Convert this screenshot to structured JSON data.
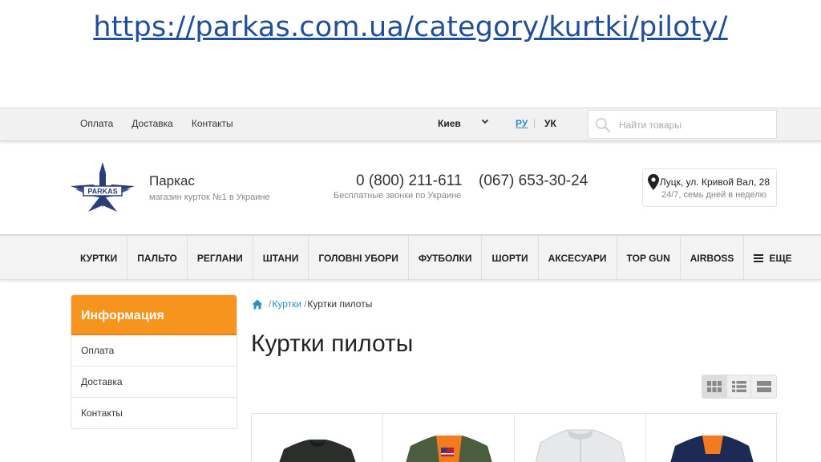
{
  "slide": {
    "url": "https://parkas.com.ua/category/kurtki/piloty/"
  },
  "topbar": {
    "links": [
      "Оплата",
      "Доставка",
      "Контакты"
    ],
    "city": "Киев",
    "lang_ru": "РУ",
    "lang_uk": "УК",
    "search_placeholder": "Найти товары"
  },
  "header": {
    "logo_text": "PARKAS",
    "brand_name": "Паркас",
    "tagline": "магазин курток №1 в Украине",
    "phone_free": "0 (800) 211-611",
    "phone_free_note": "Бесплатные звонки по Украине",
    "phone_mobile": "(067) 653-30-24",
    "address": "Луцк, ул. Кривой Вал, 28",
    "hours": "24/7, семь дней в неделю"
  },
  "nav": {
    "items": [
      "КУРТКИ",
      "ПАЛЬТО",
      "РЕГЛАНИ",
      "ШТАНИ",
      "ГОЛОВНІ УБОРИ",
      "ФУТБОЛКИ",
      "ШОРТИ",
      "АКСЕСУАРИ",
      "TOP GUN",
      "AIRBOSS"
    ],
    "more_label": "ЕЩЕ"
  },
  "sidebar": {
    "title": "Информация",
    "items": [
      "Оплата",
      "Доставка",
      "Контакты"
    ]
  },
  "breadcrumb": {
    "parent": "Куртки",
    "current": "Куртки пилоты"
  },
  "page": {
    "title": "Куртки пилоты"
  },
  "view_modes": {
    "active": "grid"
  },
  "products": [
    {
      "color": "#2b2f2c",
      "lining": "#1e2220"
    },
    {
      "color": "#4a5d3e",
      "lining": "#f47a20"
    },
    {
      "color": "#e6e8ea",
      "lining": "#cfd3d6"
    },
    {
      "color": "#1c2a55",
      "lining": "#f47a20"
    }
  ]
}
